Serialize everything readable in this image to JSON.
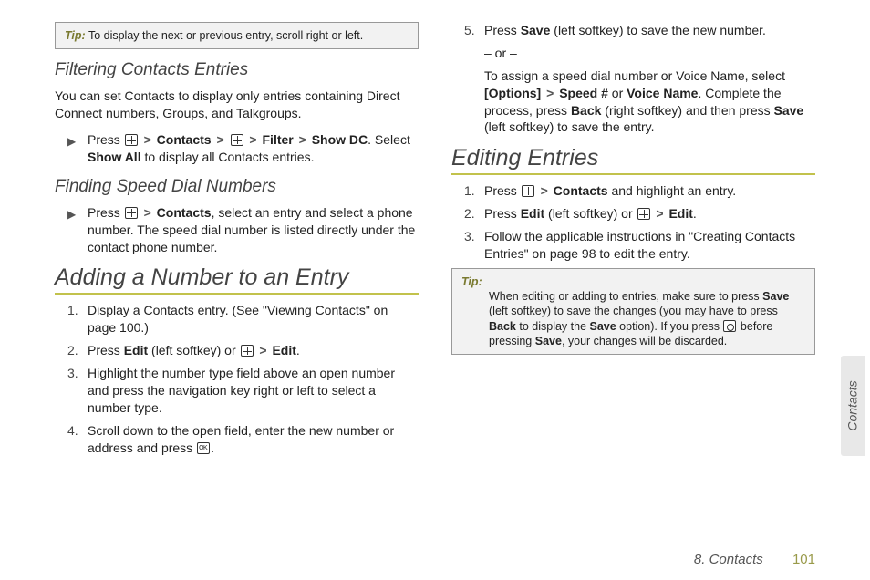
{
  "tip1": {
    "label": "Tip:",
    "text": "To display the next or previous entry, scroll right or left."
  },
  "filtering": {
    "heading": "Filtering Contacts Entries",
    "intro": "You can set Contacts to display only entries containing Direct Connect numbers, Groups, and Talkgroups.",
    "step_pre": "Press ",
    "contacts": "Contacts",
    "filter": "Filter",
    "showdc": "Show DC",
    "line2a": ". Select ",
    "showall": "Show All",
    "line2b": " to display all Contacts entries."
  },
  "finding": {
    "heading": "Finding Speed Dial Numbers",
    "step_pre": "Press ",
    "contacts": "Contacts",
    "rest": ", select an entry and select a phone number. The speed dial number is listed directly under the contact phone number."
  },
  "adding": {
    "heading": "Adding a Number to an Entry",
    "s1": "Display a Contacts entry. (See \"Viewing Contacts\" on page 100.)",
    "s2_pre": "Press ",
    "s2_edit": "Edit",
    "s2_mid": " (left softkey) or ",
    "s2_edit2": "Edit",
    "s3": "Highlight the number type field above an open number and press the navigation key right or left to select a number type.",
    "s4_a": "Scroll down to the open field, enter the new number or address and press ",
    "s5_a": "Press ",
    "s5_save": "Save",
    "s5_b": " (left softkey) to save the new number.",
    "or": "– or –",
    "s5c_a": "To assign a speed dial number or Voice Name, select ",
    "s5c_opt": "[Options]",
    "s5c_speed": "Speed #",
    "s5c_or": " or ",
    "s5c_voice": "Voice Name",
    "s5c_b": ". Complete the process, press ",
    "s5c_back": "Back",
    "s5c_c": " (right softkey) and then press ",
    "s5c_save": "Save",
    "s5c_d": " (left softkey) to save the entry."
  },
  "editing": {
    "heading": "Editing Entries",
    "s1_a": "Press ",
    "s1_contacts": "Contacts",
    "s1_b": " and highlight an entry.",
    "s2_a": "Press ",
    "s2_edit": "Edit",
    "s2_b": " (left softkey) or ",
    "s2_edit2": "Edit",
    "s3": "Follow the applicable instructions in \"Creating Contacts Entries\" on page 98 to edit the entry."
  },
  "tip2": {
    "label": "Tip:",
    "a": "When editing or adding to entries, make sure to press ",
    "save": "Save",
    "b": " (left softkey) to save the changes (you may have to press ",
    "back": "Back",
    "c": " to display the ",
    "save2": "Save",
    "d": " option). If you press ",
    "e": " before pressing ",
    "save3": "Save",
    "f": ", your changes will be discarded."
  },
  "sidetab": "Contacts",
  "footer": {
    "chapter": "8. Contacts",
    "page": "101"
  },
  "nums": {
    "n1": "1.",
    "n2": "2.",
    "n3": "3.",
    "n4": "4.",
    "n5": "5."
  },
  "gt": ">",
  "period": "."
}
